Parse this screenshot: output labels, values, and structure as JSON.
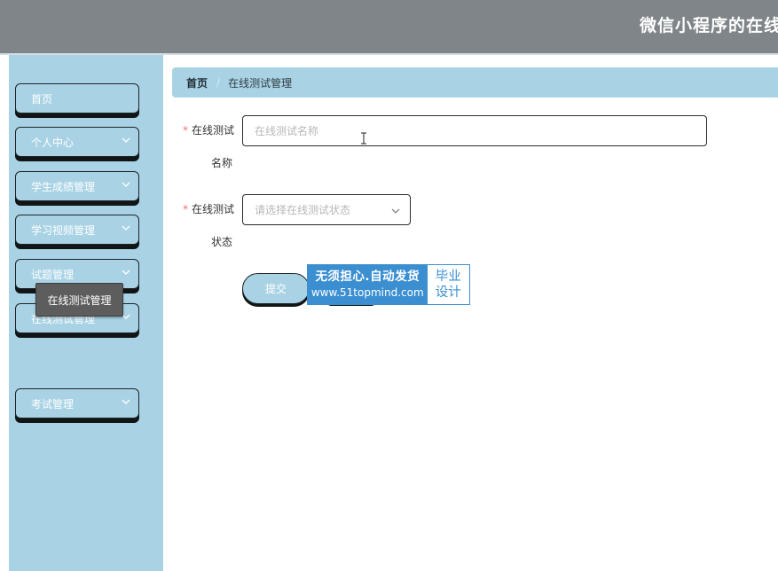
{
  "header": {
    "title": "微信小程序的在线"
  },
  "sidebar": {
    "items": [
      {
        "label": "首页",
        "has_chevron": false
      },
      {
        "label": "个人中心",
        "has_chevron": true
      },
      {
        "label": "学生成绩管理",
        "has_chevron": true
      },
      {
        "label": "学习视频管理",
        "has_chevron": true
      },
      {
        "label": "试题管理",
        "has_chevron": true
      },
      {
        "label": "在线测试管理",
        "has_chevron": true,
        "expanded": true
      },
      {
        "label": "考试管理",
        "has_chevron": true
      }
    ],
    "submenu": {
      "label": "在线测试管理"
    }
  },
  "breadcrumb": {
    "home": "首页",
    "separator": "/",
    "current": "在线测试管理"
  },
  "form": {
    "name_field": {
      "label_line1": "在线测试",
      "label_line2": "名称",
      "required_mark": "*",
      "placeholder": "在线测试名称",
      "value": ""
    },
    "status_field": {
      "label_line1": "在线测试",
      "label_line2": "状态",
      "required_mark": "*",
      "placeholder": "请选择在线测试状态",
      "selected": ""
    },
    "submit_label": "提交"
  },
  "watermark": {
    "line1": "无须担心.自动发货",
    "line2": "www.51topmind.com",
    "side_line1": "毕业",
    "side_line2": "设计"
  },
  "colors": {
    "topbar": "#7f8588",
    "sidebar": "#a9d3e5",
    "submenu_bg": "#5d5d5d",
    "required": "#f56c6c",
    "watermark_blue": "#3b8fd1"
  },
  "icons": {
    "menu_chevron": "chevron-down-icon",
    "text_cursor": "ibeam-cursor-icon"
  }
}
